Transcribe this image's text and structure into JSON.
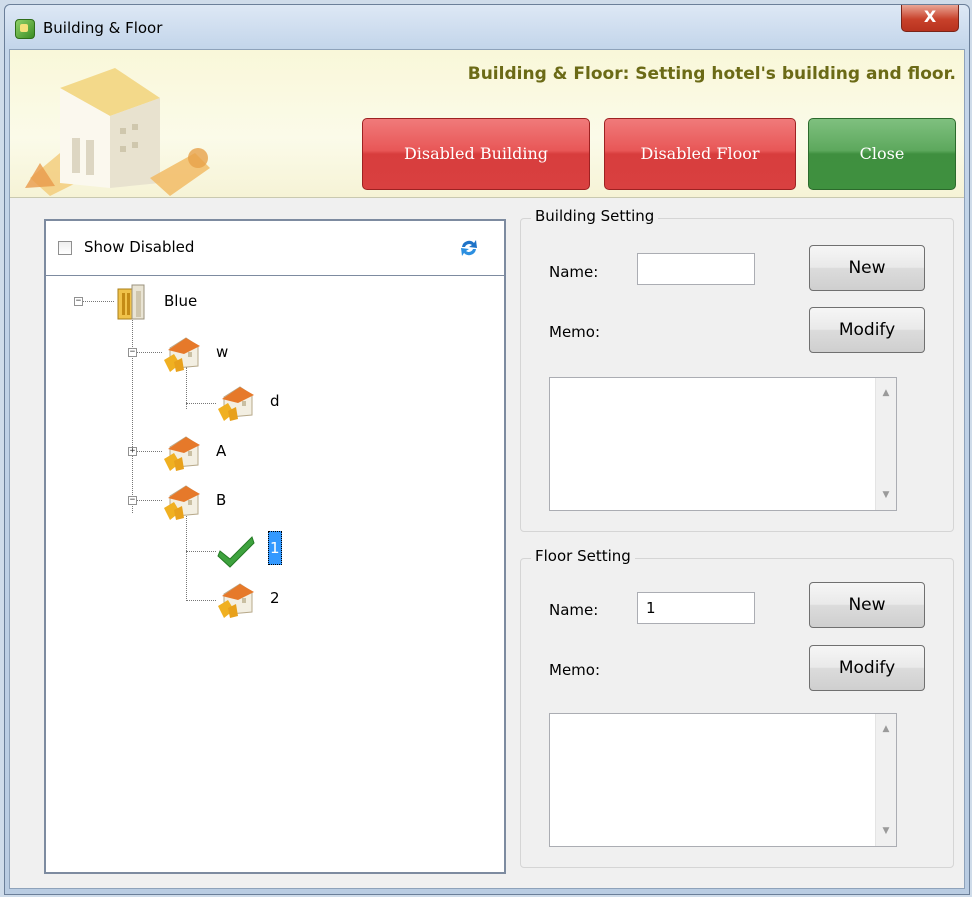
{
  "window": {
    "title": "Building & Floor",
    "close_glyph": "X"
  },
  "header": {
    "description": "Building & Floor: Setting hotel's building and floor.",
    "buttons": {
      "disabled_building": "Disabled Building",
      "disabled_floor": "Disabled Floor",
      "close": "Close"
    },
    "colors": {
      "red": "#e04848",
      "green": "#4f9d4f",
      "title": "#6b6a16"
    }
  },
  "tree": {
    "show_disabled_label": "Show Disabled",
    "show_disabled_checked": false,
    "nodes": [
      {
        "label": "Blue",
        "level": 0,
        "icon": "tall-building-icon",
        "expander": "minus"
      },
      {
        "label": "w",
        "level": 1,
        "icon": "house-icon",
        "expander": "minus"
      },
      {
        "label": "d",
        "level": 2,
        "icon": "house-icon"
      },
      {
        "label": "A",
        "level": 1,
        "icon": "house-icon",
        "expander": "plus"
      },
      {
        "label": "B",
        "level": 1,
        "icon": "house-icon",
        "expander": "minus"
      },
      {
        "label": "1",
        "level": 2,
        "icon": "checkmark-icon",
        "selected": true
      },
      {
        "label": "2",
        "level": 2,
        "icon": "house-icon"
      }
    ]
  },
  "building_setting": {
    "title": "Building Setting",
    "name_label": "Name:",
    "name_value": "",
    "memo_label": "Memo:",
    "new_label": "New",
    "modify_label": "Modify",
    "memo_value": ""
  },
  "floor_setting": {
    "title": "Floor Setting",
    "name_label": "Name:",
    "name_value": "1",
    "memo_label": "Memo:",
    "new_label": "New",
    "modify_label": "Modify",
    "memo_value": ""
  },
  "scroll_up_glyph": "▲",
  "scroll_down_glyph": "▼"
}
